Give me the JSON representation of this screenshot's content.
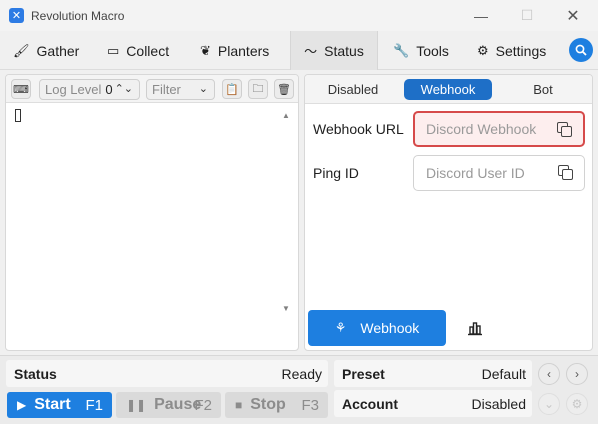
{
  "window": {
    "title": "Revolution Macro",
    "icon": "app-logo-icon"
  },
  "tabs": [
    {
      "label": "Gather",
      "icon": "brush-icon"
    },
    {
      "label": "Collect",
      "icon": "ticket-icon"
    },
    {
      "label": "Planters",
      "icon": "sprout-icon"
    },
    {
      "label": "Status",
      "icon": "pulse-icon",
      "active": true
    },
    {
      "label": "Tools",
      "icon": "wrench-icon"
    },
    {
      "label": "Settings",
      "icon": "gear-icon"
    }
  ],
  "log": {
    "level_label": "Log Level",
    "level_value": "0",
    "filter_label": "Filter"
  },
  "webhook_modes": [
    "Disabled",
    "Webhook",
    "Bot"
  ],
  "active_mode": "Webhook",
  "fields": {
    "webhook_url": {
      "label": "Webhook URL",
      "placeholder": "Discord Webhook"
    },
    "ping_id": {
      "label": "Ping ID",
      "placeholder": "Discord User ID"
    }
  },
  "webhook_button": "Webhook",
  "bottom": {
    "status_label": "Status",
    "status_value": "Ready",
    "preset_label": "Preset",
    "preset_value": "Default",
    "account_label": "Account",
    "account_value": "Disabled",
    "start_label": "Start",
    "start_key": "F1",
    "pause_label": "Pause",
    "pause_key": "F2",
    "stop_label": "Stop",
    "stop_key": "F3"
  },
  "colors": {
    "accent": "#1e7fe0",
    "segment_active": "#1e6fc7",
    "error_border": "#d64a4a",
    "error_fill": "#fdeeee"
  }
}
